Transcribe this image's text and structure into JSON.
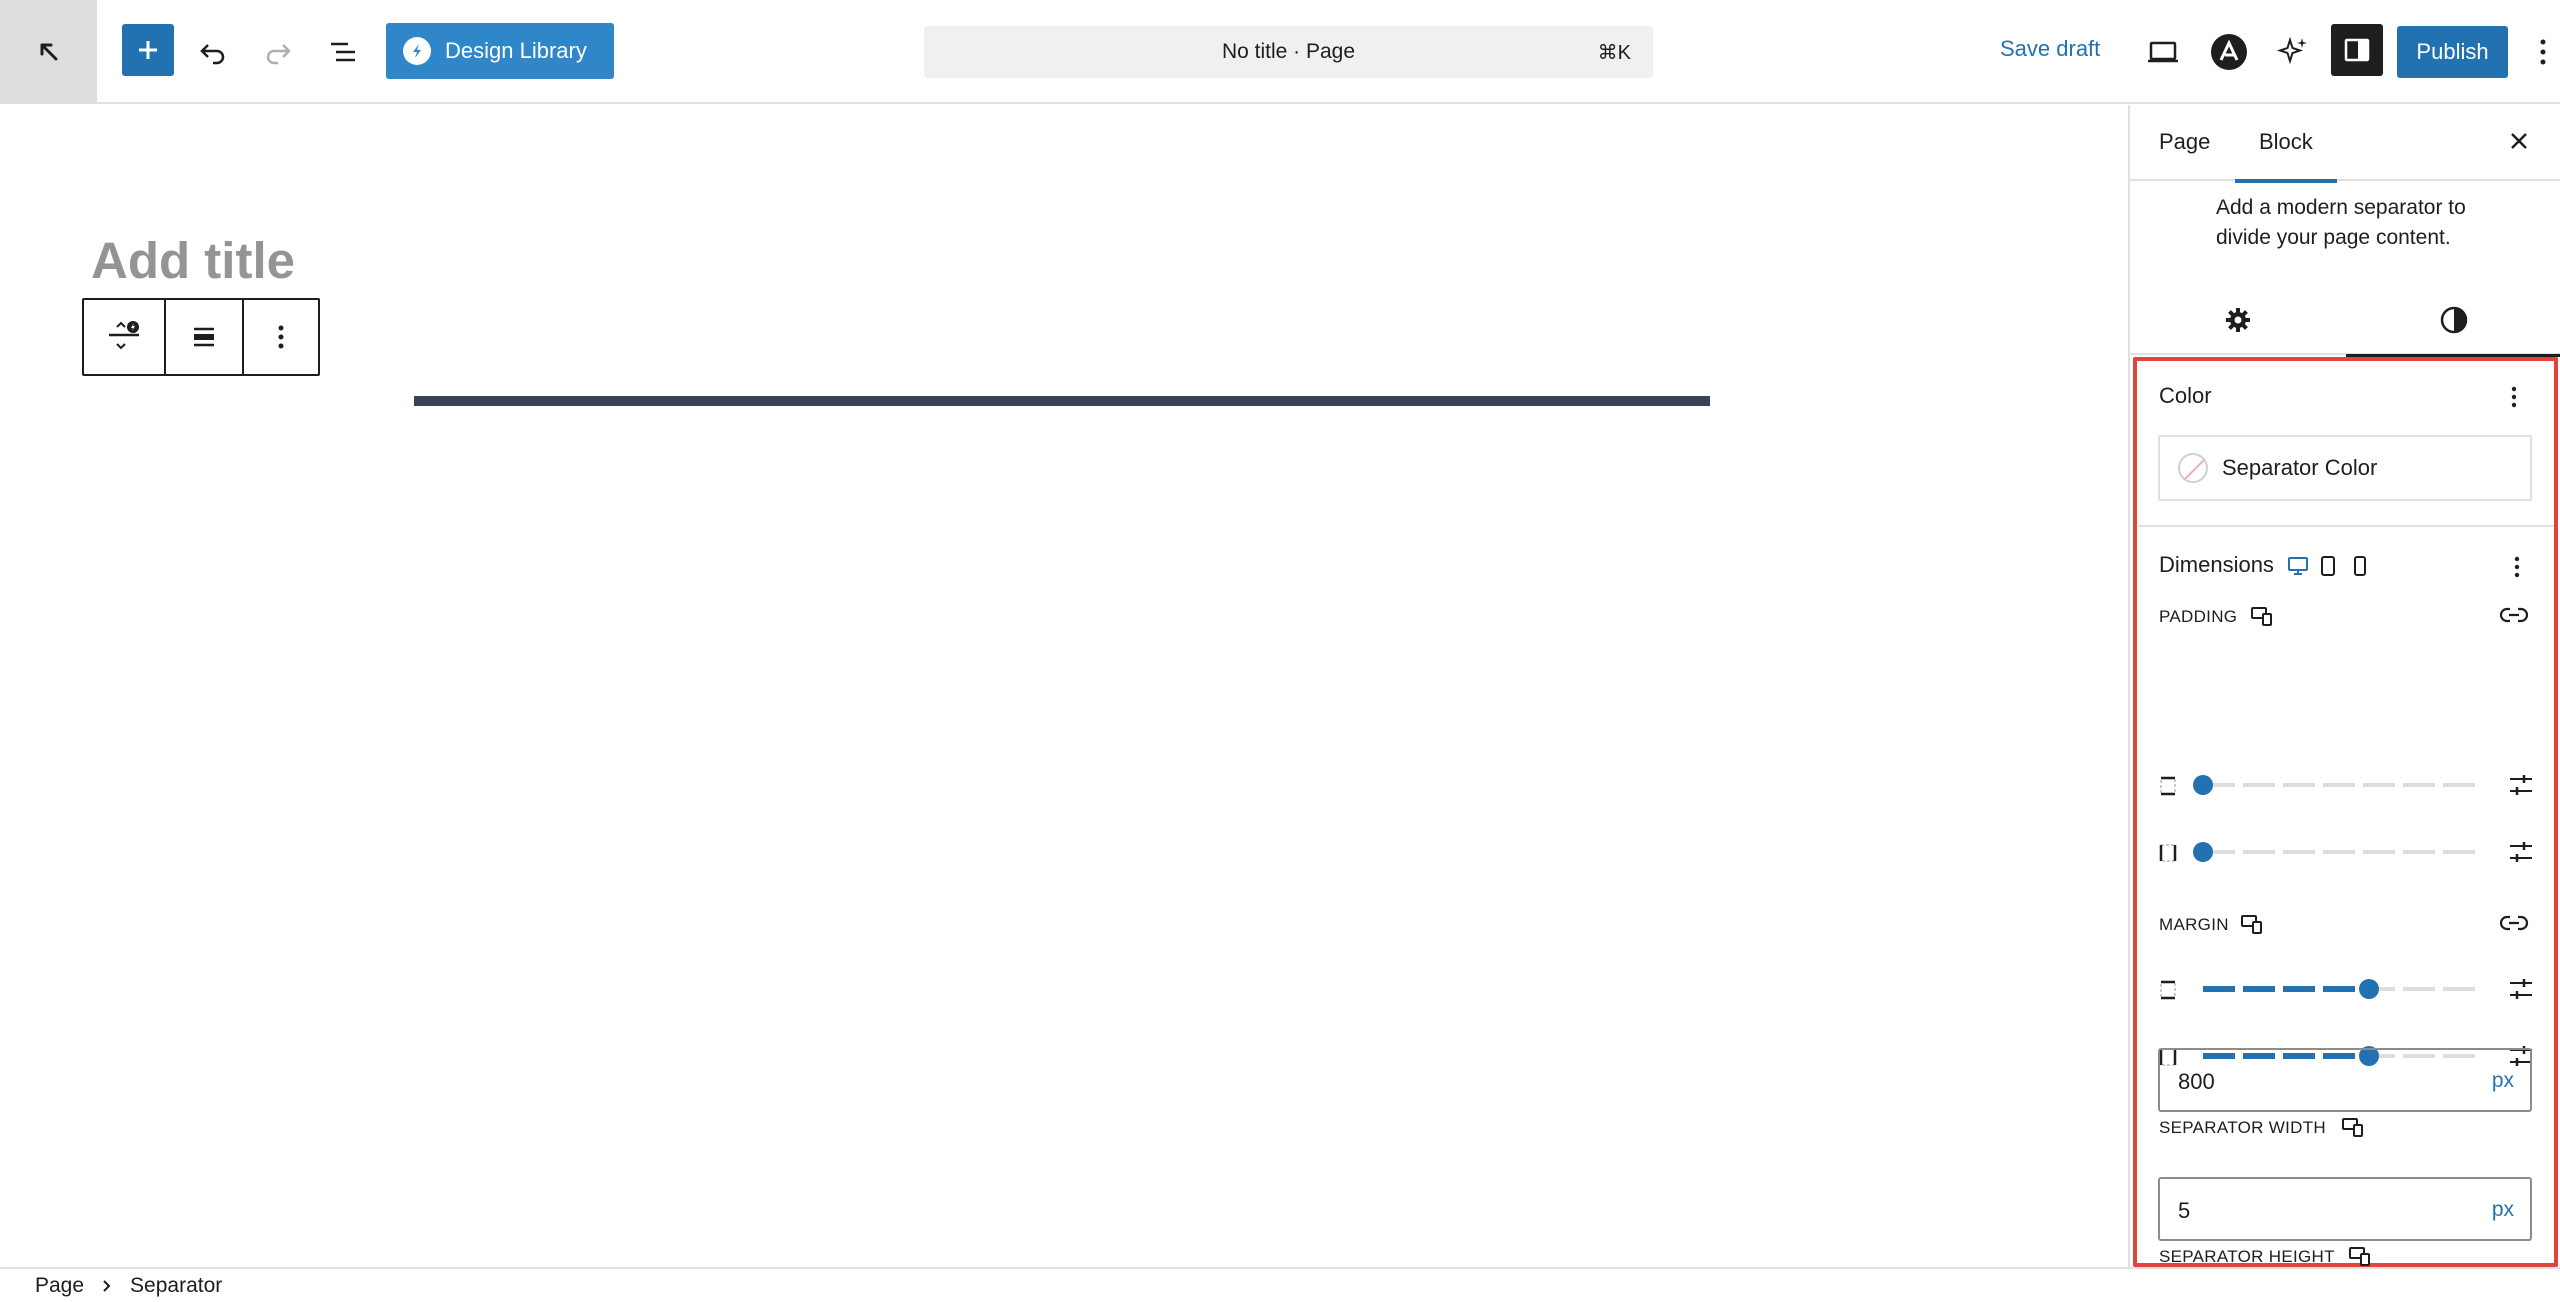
{
  "toolbar": {
    "design_library_label": "Design Library",
    "command_bar_text": "No title · Page",
    "command_shortcut": "⌘K",
    "save_draft_label": "Save draft",
    "publish_label": "Publish"
  },
  "canvas": {
    "title_placeholder": "Add title"
  },
  "breadcrumb": {
    "items": [
      "Page",
      "Separator"
    ]
  },
  "sidebar": {
    "tabs": [
      "Page",
      "Block"
    ],
    "active_tab": "Block",
    "block_description": "Add a modern separator to divide your page content.",
    "sub_tabs": [
      "settings-icon",
      "styles-icon"
    ],
    "color": {
      "title": "Color",
      "separator_color_label": "Separator Color"
    },
    "dimensions": {
      "title": "Dimensions",
      "padding_label": "PADDING",
      "margin_label": "MARGIN",
      "padding_levels": [
        0,
        0
      ],
      "margin_levels": [
        0.6,
        0.6
      ],
      "separator_width_label": "SEPARATOR WIDTH",
      "separator_width_value": "800",
      "separator_width_unit": "px",
      "separator_height_label": "SEPARATOR HEIGHT",
      "separator_height_value": "5",
      "separator_height_unit": "px"
    }
  },
  "colors": {
    "accent": "#2271b1",
    "highlight": "#e0443a",
    "separator": "#3a4353"
  }
}
